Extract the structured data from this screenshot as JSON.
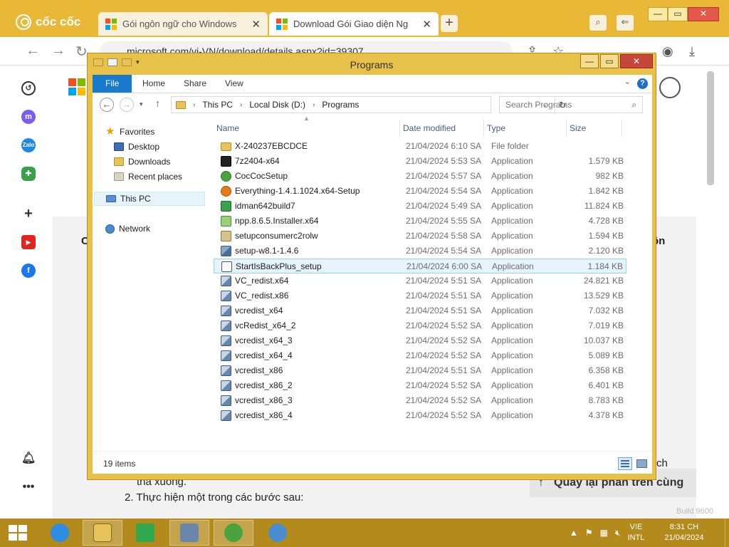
{
  "browser": {
    "brand": "cốc cốc",
    "tabs": [
      {
        "title": "Gói ngôn ngữ cho Windows",
        "close": "✕"
      },
      {
        "title": "Download Gói Giao diện Ng",
        "close": "✕"
      }
    ],
    "new_tab": "+",
    "address": "microsoft.com/vi-VN/download/details.aspx?id=39307",
    "window_controls": {
      "minimize": "—",
      "maximize": "▭",
      "close": "✕"
    }
  },
  "page": {
    "left_fragment": "C",
    "right_fragment": "ôn",
    "right_fragment_2": "ch",
    "line_1": "thả xuống.",
    "line_2": "2.  Thực hiện một trong các bước sau:",
    "back_to_top": "Quay lại phần trên cùng",
    "build": "Build 9600"
  },
  "explorer": {
    "title": "Programs",
    "ribbon_tabs": [
      "File",
      "Home",
      "Share",
      "View"
    ],
    "help": "?",
    "breadcrumb": [
      "This PC",
      "Local Disk (D:)",
      "Programs"
    ],
    "search_placeholder": "Search Programs",
    "nav": {
      "favorites": "Favorites",
      "desktop": "Desktop",
      "downloads": "Downloads",
      "recent": "Recent places",
      "this_pc": "This PC",
      "network": "Network"
    },
    "columns": {
      "name": "Name",
      "date": "Date modified",
      "type": "Type",
      "size": "Size"
    },
    "files": [
      {
        "name": "X-240237EBCDCE",
        "date": "21/04/2024 6:10 SA",
        "type": "File folder",
        "size": "",
        "icon": "folder"
      },
      {
        "name": "7z2404-x64",
        "date": "21/04/2024 5:53 SA",
        "type": "Application",
        "size": "1.579 KB",
        "icon": "7z"
      },
      {
        "name": "CocCocSetup",
        "date": "21/04/2024 5:57 SA",
        "type": "Application",
        "size": "982 KB",
        "icon": "coc"
      },
      {
        "name": "Everything-1.4.1.1024.x64-Setup",
        "date": "21/04/2024 5:54 SA",
        "type": "Application",
        "size": "1.842 KB",
        "icon": "every"
      },
      {
        "name": "idman642build7",
        "date": "21/04/2024 5:49 SA",
        "type": "Application",
        "size": "11.824 KB",
        "icon": "idm"
      },
      {
        "name": "npp.8.6.5.Installer.x64",
        "date": "21/04/2024 5:55 SA",
        "type": "Application",
        "size": "4.728 KB",
        "icon": "npp"
      },
      {
        "name": "setupconsumerc2rolw",
        "date": "21/04/2024 5:58 SA",
        "type": "Application",
        "size": "1.594 KB",
        "icon": "setup"
      },
      {
        "name": "setup-w8.1-1.4.6",
        "date": "21/04/2024 5:54 SA",
        "type": "Application",
        "size": "2.120 KB",
        "icon": "app"
      },
      {
        "name": "StartIsBackPlus_setup",
        "date": "21/04/2024 6:00 SA",
        "type": "Application",
        "size": "1.184 KB",
        "icon": "start"
      },
      {
        "name": "VC_redist.x64",
        "date": "21/04/2024 5:51 SA",
        "type": "Application",
        "size": "24.821 KB",
        "icon": "vc"
      },
      {
        "name": "VC_redist.x86",
        "date": "21/04/2024 5:51 SA",
        "type": "Application",
        "size": "13.529 KB",
        "icon": "vc"
      },
      {
        "name": "vcredist_x64",
        "date": "21/04/2024 5:51 SA",
        "type": "Application",
        "size": "7.032 KB",
        "icon": "vc"
      },
      {
        "name": "vcRedist_x64_2",
        "date": "21/04/2024 5:52 SA",
        "type": "Application",
        "size": "7.019 KB",
        "icon": "vc"
      },
      {
        "name": "vcredist_x64_3",
        "date": "21/04/2024 5:52 SA",
        "type": "Application",
        "size": "10.037 KB",
        "icon": "vc"
      },
      {
        "name": "vcredist_x64_4",
        "date": "21/04/2024 5:52 SA",
        "type": "Application",
        "size": "5.089 KB",
        "icon": "vc"
      },
      {
        "name": "vcredist_x86",
        "date": "21/04/2024 5:51 SA",
        "type": "Application",
        "size": "6.358 KB",
        "icon": "vc"
      },
      {
        "name": "vcredist_x86_2",
        "date": "21/04/2024 5:52 SA",
        "type": "Application",
        "size": "6.401 KB",
        "icon": "vc"
      },
      {
        "name": "vcredist_x86_3",
        "date": "21/04/2024 5:52 SA",
        "type": "Application",
        "size": "8.783 KB",
        "icon": "vc"
      },
      {
        "name": "vcredist_x86_4",
        "date": "21/04/2024 5:52 SA",
        "type": "Application",
        "size": "4.378 KB",
        "icon": "vc"
      }
    ],
    "selected_file": "StartIsBackPlus_setup",
    "status": "19 items"
  },
  "taskbar": {
    "lang": [
      "VIE",
      "INTL"
    ],
    "time": "8:31 CH",
    "date": "21/04/2024"
  },
  "colors": {
    "accent": "#e8b836",
    "selection": "#e5f3fb",
    "file_tab": "#1979ca"
  }
}
